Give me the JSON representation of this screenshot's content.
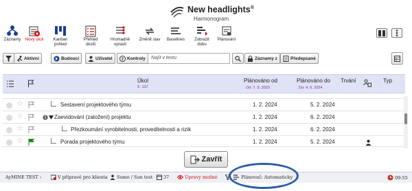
{
  "app": {
    "title": "New headlights",
    "title_mark": "®",
    "subtitle": "Harmonogram"
  },
  "toolbar": {
    "items": [
      {
        "label": "Záznamy",
        "icon": "tree-icon"
      },
      {
        "label": "Nový úkol",
        "icon": "new-task-icon",
        "accent": "#cc0000"
      },
      {
        "label": "Kanban\npohled",
        "icon": "kanban-icon"
      },
      {
        "label": "Přehled\núkolů",
        "icon": "task-overview-icon"
      },
      {
        "label": "Hromadně\nupravit",
        "icon": "bulk-edit-icon"
      },
      {
        "label": "Změnit stav",
        "icon": "change-state-icon"
      },
      {
        "label": "Baselines",
        "icon": "baselines-icon"
      },
      {
        "label": "Zobrazit\ndobu",
        "icon": "show-time-icon"
      },
      {
        "label": "Plánování",
        "icon": "planning-icon"
      }
    ]
  },
  "filters": {
    "active": "Aktivní",
    "future": "Budoucí",
    "user": "Uživatel",
    "checks": "Kontroly",
    "search_placeholder": "Najít v textu",
    "records_from": "Záznamy z",
    "preset": "Předepsané"
  },
  "table": {
    "headers": {
      "task": "Úkol",
      "task_count": "Σ: 137",
      "planned_from": "Plánováno od",
      "planned_from_sub": "Od: 7. 9. 2023",
      "planned_to": "Plánováno do",
      "planned_to_sub": "Do: 4. 6. 2024",
      "duration": "Trvání",
      "type": "Typ"
    },
    "rows": [
      {
        "name": "Sestavení projektového týmu",
        "from": "1. 2. 2024",
        "to": "5. 2. 2024"
      },
      {
        "name": "Zaevidování (založení) projektu",
        "from": "1. 2. 2024",
        "to": "6. 2. 2024"
      },
      {
        "name": "Přezkoumání vyrobitelnosti, proveditelnosti a rizik",
        "from": "1. 2. 2024",
        "to": "6. 2. 2024"
      },
      {
        "name": "Porada projektového týmu",
        "from": "1. 2. 2024",
        "to": "5. 2. 2024"
      }
    ]
  },
  "close_button": {
    "label": "Zavřít"
  },
  "statusbar": {
    "env": "AyMINE TEST",
    "project_state": "V přípravě pro klienta",
    "user": "Sumo / Sun test",
    "count": "37",
    "edit_mode": "Úpravy možné",
    "planner": "Plánovač: Automaticky",
    "time": "09:55"
  },
  "colors": {
    "header_bg": "#dfe3f5",
    "accent_purple": "#8a2ba0",
    "annotation_blue": "#2a5aa8"
  }
}
